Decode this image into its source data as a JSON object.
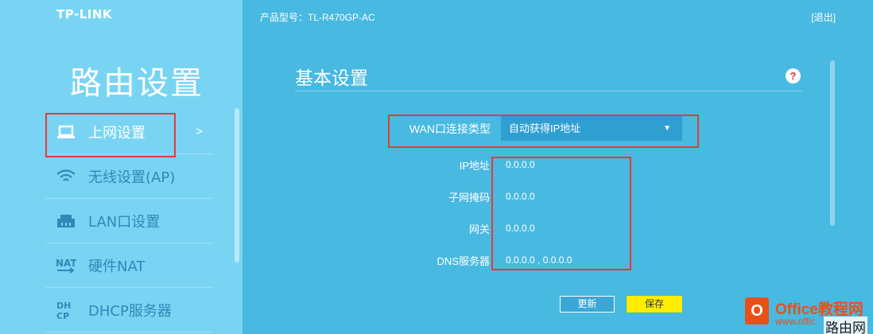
{
  "brand": {
    "logo": "TP-LINK",
    "accent": "#48b9e0",
    "sidebar_bg": "#79d4f4",
    "highlight": "#e53a3a"
  },
  "sidebar": {
    "title": "路由设置",
    "items": [
      {
        "label": "上网设置",
        "icon": "laptop-icon",
        "active": true,
        "arrow": ">"
      },
      {
        "label": "无线设置(AP)",
        "icon": "wifi-icon"
      },
      {
        "label": "LAN口设置",
        "icon": "lan-icon"
      },
      {
        "label": "硬件NAT",
        "icon": "nat-icon"
      },
      {
        "label": "DHCP服务器",
        "icon": "dhcp-icon"
      }
    ]
  },
  "header": {
    "model_label": "产品型号：TL-R470GP-AC",
    "logout": "[退出]"
  },
  "main": {
    "title": "基本设置",
    "help": "?",
    "wan_type_label": "WAN口连接类型",
    "wan_type_value": "自动获得IP地址",
    "fields": [
      {
        "label": "IP地址",
        "value": "0.0.0.0"
      },
      {
        "label": "子网掩码",
        "value": "0.0.0.0"
      },
      {
        "label": "网关",
        "value": "0.0.0.0"
      },
      {
        "label": "DNS服务器",
        "value": "0.0.0.0 , 0.0.0.0"
      }
    ],
    "buttons": {
      "refresh": "更新",
      "save": "保存"
    }
  },
  "watermark": {
    "logo_letter": "O",
    "line1": "Office教程网",
    "line2": "www.offic",
    "line3": "路由网"
  }
}
